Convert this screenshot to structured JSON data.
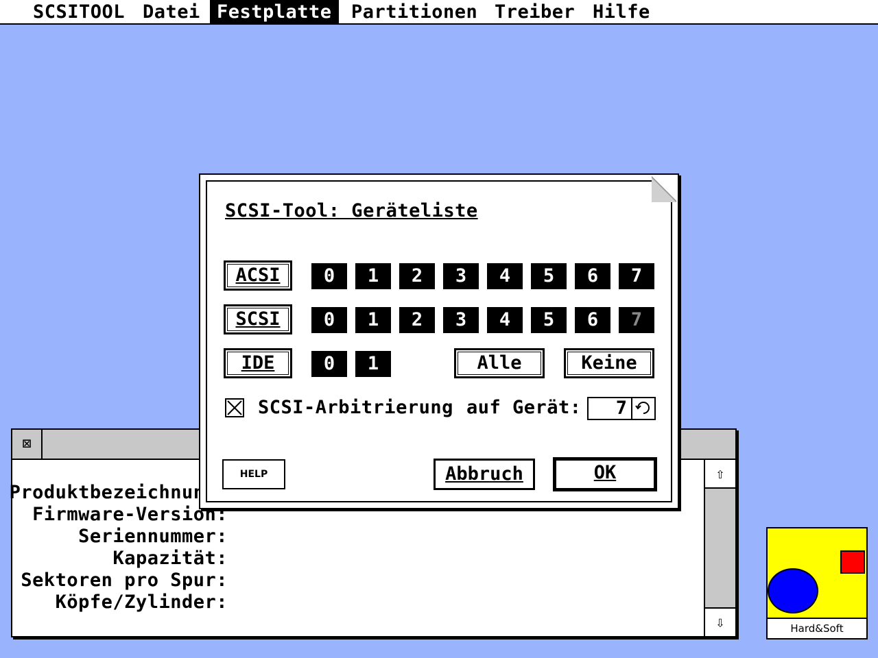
{
  "menubar": {
    "items": [
      "SCSITOOL",
      "Datei",
      "Festplatte",
      "Partitionen",
      "Treiber",
      "Hilfe"
    ],
    "active": "Festplatte"
  },
  "background_window": {
    "close_glyph": "⊠",
    "labels": [
      "Produktbezeichnung:",
      "Firmware-Version:",
      "Seriennummer:",
      "Kapazität:",
      "Sektoren pro Spur:",
      "Köpfe/Zylinder:"
    ],
    "scroll_up_glyph": "⇧",
    "scroll_down_glyph": "⇩"
  },
  "desktop_icon": {
    "label": "Hard&Soft",
    "colors": {
      "background": "#ffff00",
      "circle": "#0000ff",
      "square": "#ff0000"
    }
  },
  "dialog": {
    "title": "SCSI-Tool: Geräteliste",
    "buses": [
      {
        "name": "ACSI",
        "ids": [
          "0",
          "1",
          "2",
          "3",
          "4",
          "5",
          "6",
          "7"
        ],
        "disabled_ids": []
      },
      {
        "name": "SCSI",
        "ids": [
          "0",
          "1",
          "2",
          "3",
          "4",
          "5",
          "6",
          "7"
        ],
        "disabled_ids": [
          "7"
        ]
      },
      {
        "name": "IDE",
        "ids": [
          "0",
          "1"
        ],
        "disabled_ids": []
      }
    ],
    "all_button": "Alle",
    "none_button": "Keine",
    "arbitration": {
      "checked": true,
      "label": "SCSI-Arbitrierung",
      "device_label": "auf Gerät:",
      "device_value": "7"
    },
    "help_button": "HELP",
    "cancel_button": "Abbruch",
    "ok_button": "OK"
  },
  "colors": {
    "desktop": "#99b3fd",
    "scrollbar": "#c8c8c8"
  }
}
